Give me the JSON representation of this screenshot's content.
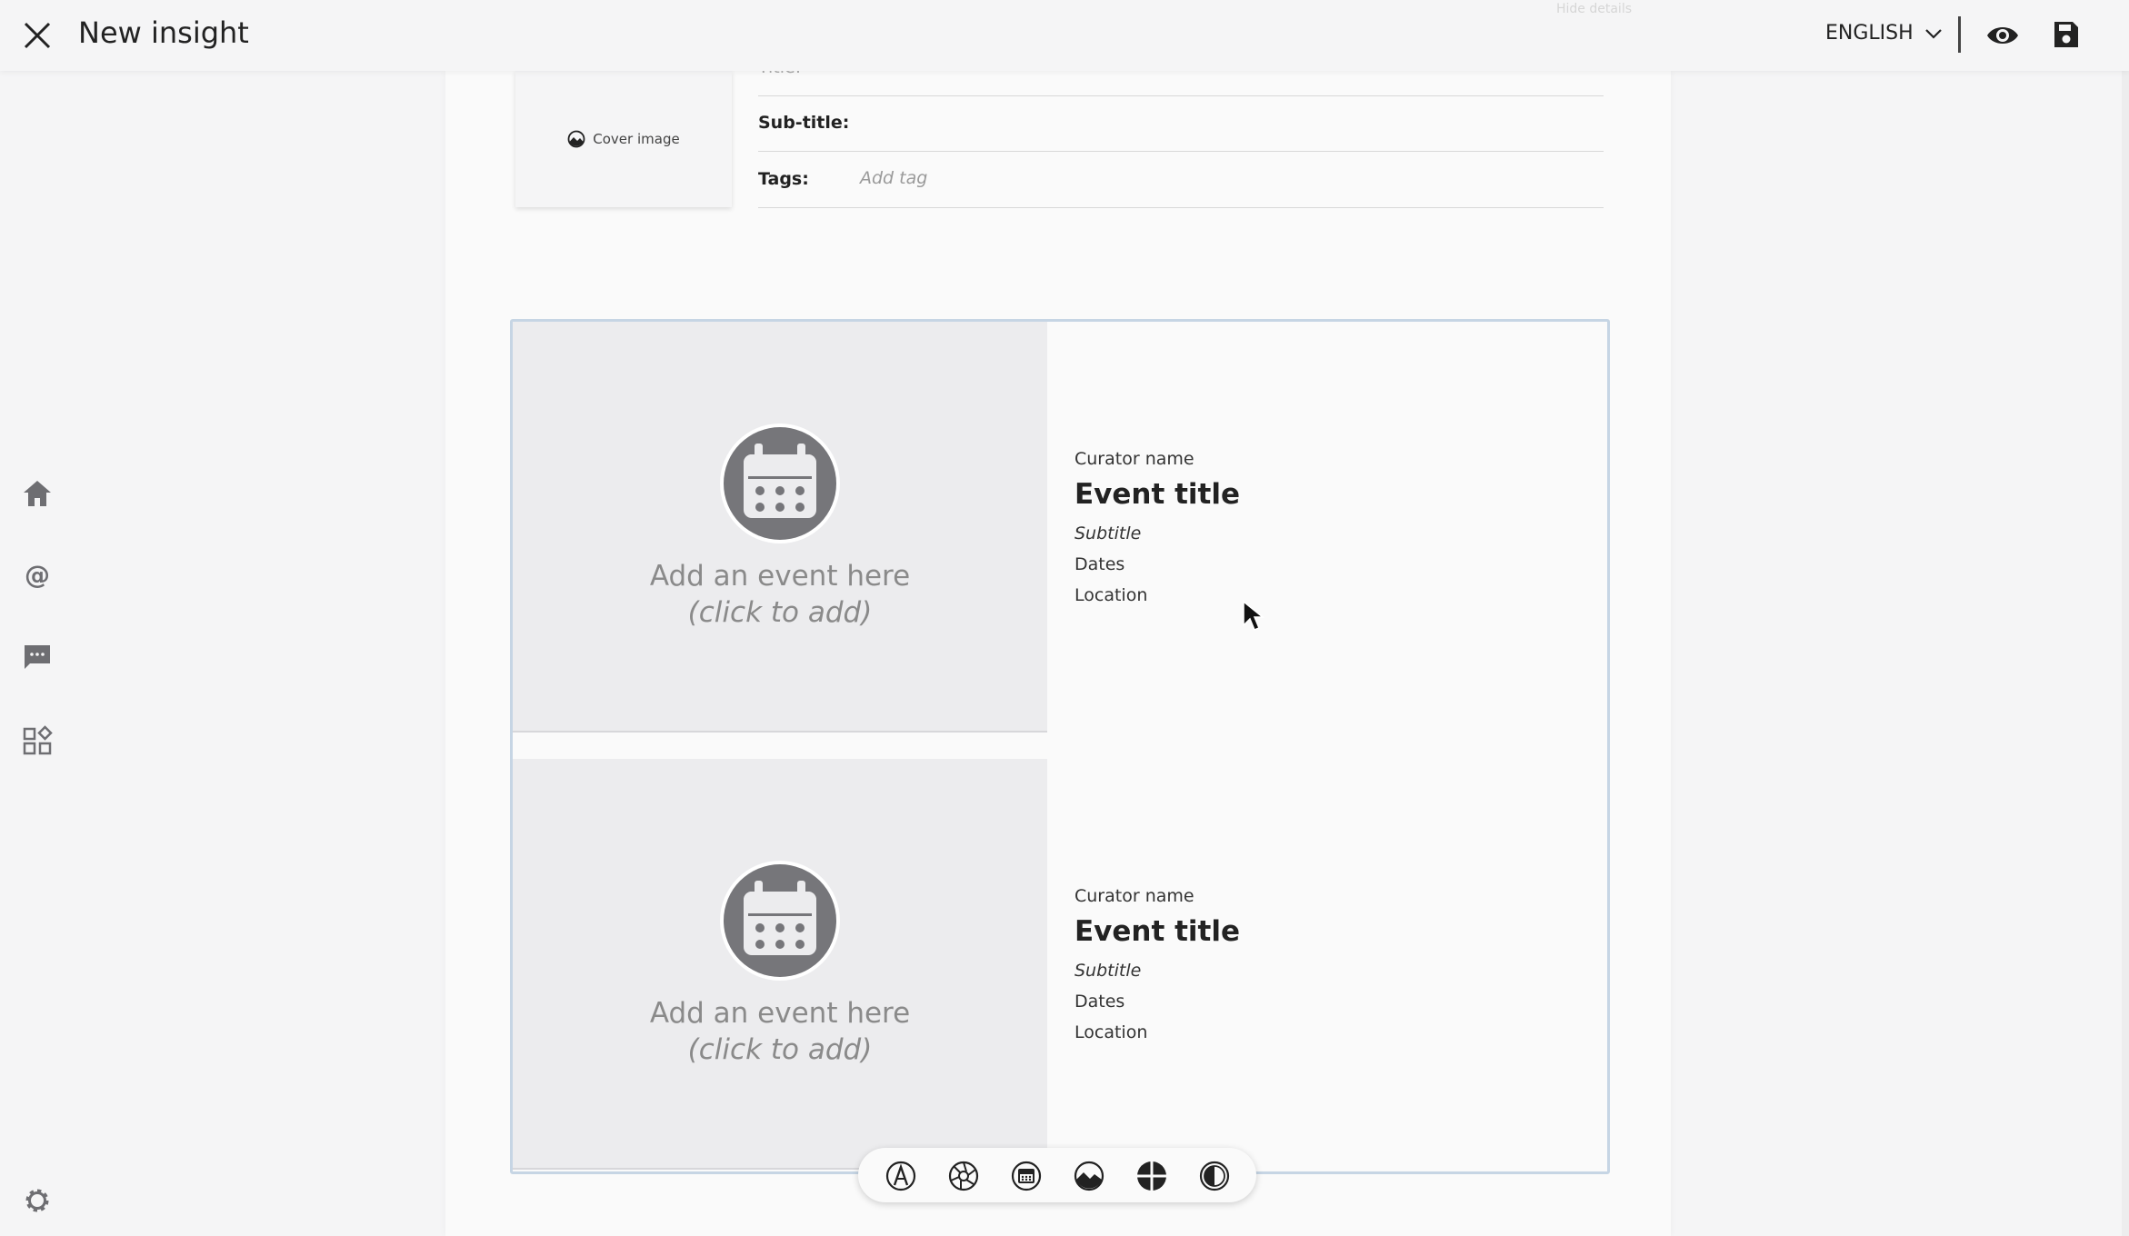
{
  "header": {
    "title": "New insight",
    "hidden_details": "Hide details",
    "language": "ENGLISH"
  },
  "metadata": {
    "cover_label": "Cover image",
    "title_label": "Title:",
    "subtitle_label": "Sub-title:",
    "tags_label": "Tags:",
    "tags_placeholder": "Add tag"
  },
  "events": [
    {
      "add_text": "Add an event here",
      "click_hint": "(click to add)",
      "curator": "Curator name",
      "title": "Event title",
      "subtitle": "Subtitle",
      "dates": "Dates",
      "location": "Location"
    },
    {
      "add_text": "Add an event here",
      "click_hint": "(click to add)",
      "curator": "Curator name",
      "title": "Event title",
      "subtitle": "Subtitle",
      "dates": "Dates",
      "location": "Location"
    }
  ],
  "sidebar_icons": [
    "home-icon",
    "mention-icon",
    "chat-icon",
    "widgets-icon",
    "settings-icon"
  ],
  "toolbar_icons": [
    "text-tool-icon",
    "aperture-tool-icon",
    "event-tool-icon",
    "image-tool-icon",
    "layout-tool-icon",
    "contrast-tool-icon"
  ],
  "colors": {
    "background": "#f5f5f6",
    "canvas": "#fafafa",
    "selection_border": "#c6d5e4",
    "icon_gray": "#6e6e72"
  }
}
